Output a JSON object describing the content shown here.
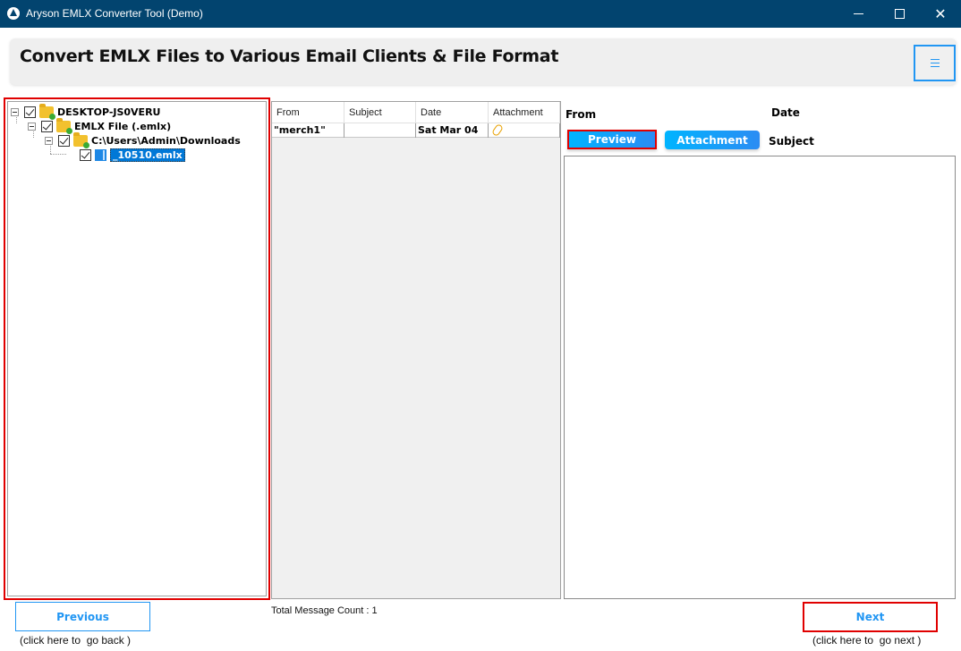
{
  "window": {
    "title": "Aryson EMLX Converter Tool (Demo)",
    "controls": {
      "minimize": "minimize",
      "maximize": "maximize",
      "close": "✕"
    }
  },
  "header": {
    "title": "Convert EMLX Files to Various Email Clients & File Format",
    "menu_icon": "hamburger-menu-icon"
  },
  "tree": {
    "nodes": [
      {
        "label": "DESKTOP-JS0VERU",
        "checked": true,
        "icon": "folder-icon",
        "level": 0
      },
      {
        "label": "EMLX File (.emlx)",
        "checked": true,
        "icon": "folder-icon",
        "level": 1
      },
      {
        "label": "C:\\Users\\Admin\\Downloads",
        "checked": true,
        "icon": "folder-icon",
        "level": 2
      },
      {
        "label": "_10510.emlx",
        "checked": true,
        "icon": "file-icon",
        "level": 3,
        "selected": true
      }
    ]
  },
  "messages": {
    "columns": [
      "From",
      "Subject",
      "Date",
      "Attachment"
    ],
    "rows": [
      {
        "from": "\"merch1\"",
        "subject": "",
        "date": "Sat Mar 04",
        "attachment": "paperclip-icon"
      }
    ],
    "total_label": "Total Message Count : 1"
  },
  "preview": {
    "from_label": "From",
    "date_label": "Date",
    "subject_label": "Subject",
    "preview_button": "Preview",
    "attachment_button": "Attachment"
  },
  "footer": {
    "previous_label": "Previous",
    "previous_hint": "(click here to  go back )",
    "next_label": "Next",
    "next_hint": "(click here to  go next )"
  },
  "colors": {
    "titlebar": "#02446f",
    "accent_blue": "#2196f3",
    "highlight_red": "#e00000",
    "selection": "#0078d7"
  }
}
